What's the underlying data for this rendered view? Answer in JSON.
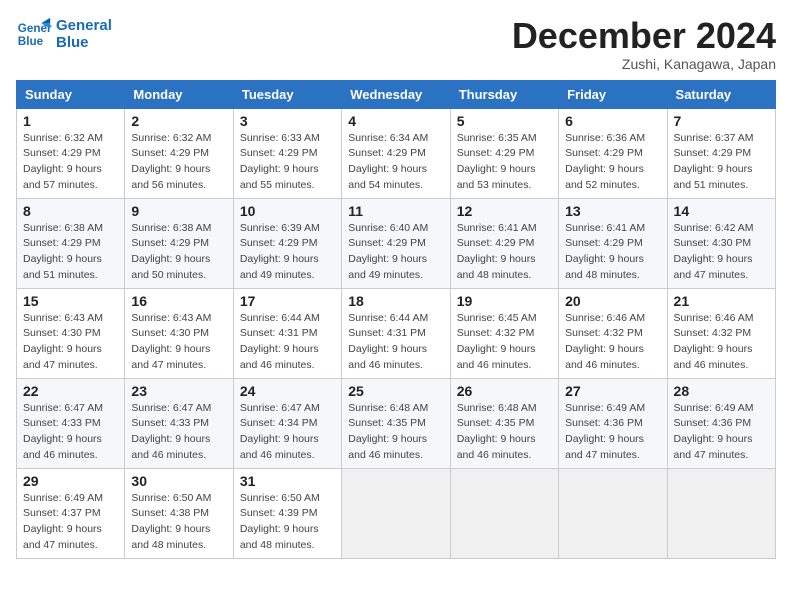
{
  "header": {
    "logo_line1": "General",
    "logo_line2": "Blue",
    "month_title": "December 2024",
    "subtitle": "Zushi, Kanagawa, Japan"
  },
  "weekdays": [
    "Sunday",
    "Monday",
    "Tuesday",
    "Wednesday",
    "Thursday",
    "Friday",
    "Saturday"
  ],
  "weeks": [
    [
      {
        "day": "1",
        "sunrise": "6:32 AM",
        "sunset": "4:29 PM",
        "daylight": "9 hours and 57 minutes."
      },
      {
        "day": "2",
        "sunrise": "6:32 AM",
        "sunset": "4:29 PM",
        "daylight": "9 hours and 56 minutes."
      },
      {
        "day": "3",
        "sunrise": "6:33 AM",
        "sunset": "4:29 PM",
        "daylight": "9 hours and 55 minutes."
      },
      {
        "day": "4",
        "sunrise": "6:34 AM",
        "sunset": "4:29 PM",
        "daylight": "9 hours and 54 minutes."
      },
      {
        "day": "5",
        "sunrise": "6:35 AM",
        "sunset": "4:29 PM",
        "daylight": "9 hours and 53 minutes."
      },
      {
        "day": "6",
        "sunrise": "6:36 AM",
        "sunset": "4:29 PM",
        "daylight": "9 hours and 52 minutes."
      },
      {
        "day": "7",
        "sunrise": "6:37 AM",
        "sunset": "4:29 PM",
        "daylight": "9 hours and 51 minutes."
      }
    ],
    [
      {
        "day": "8",
        "sunrise": "6:38 AM",
        "sunset": "4:29 PM",
        "daylight": "9 hours and 51 minutes."
      },
      {
        "day": "9",
        "sunrise": "6:38 AM",
        "sunset": "4:29 PM",
        "daylight": "9 hours and 50 minutes."
      },
      {
        "day": "10",
        "sunrise": "6:39 AM",
        "sunset": "4:29 PM",
        "daylight": "9 hours and 49 minutes."
      },
      {
        "day": "11",
        "sunrise": "6:40 AM",
        "sunset": "4:29 PM",
        "daylight": "9 hours and 49 minutes."
      },
      {
        "day": "12",
        "sunrise": "6:41 AM",
        "sunset": "4:29 PM",
        "daylight": "9 hours and 48 minutes."
      },
      {
        "day": "13",
        "sunrise": "6:41 AM",
        "sunset": "4:29 PM",
        "daylight": "9 hours and 48 minutes."
      },
      {
        "day": "14",
        "sunrise": "6:42 AM",
        "sunset": "4:30 PM",
        "daylight": "9 hours and 47 minutes."
      }
    ],
    [
      {
        "day": "15",
        "sunrise": "6:43 AM",
        "sunset": "4:30 PM",
        "daylight": "9 hours and 47 minutes."
      },
      {
        "day": "16",
        "sunrise": "6:43 AM",
        "sunset": "4:30 PM",
        "daylight": "9 hours and 47 minutes."
      },
      {
        "day": "17",
        "sunrise": "6:44 AM",
        "sunset": "4:31 PM",
        "daylight": "9 hours and 46 minutes."
      },
      {
        "day": "18",
        "sunrise": "6:44 AM",
        "sunset": "4:31 PM",
        "daylight": "9 hours and 46 minutes."
      },
      {
        "day": "19",
        "sunrise": "6:45 AM",
        "sunset": "4:32 PM",
        "daylight": "9 hours and 46 minutes."
      },
      {
        "day": "20",
        "sunrise": "6:46 AM",
        "sunset": "4:32 PM",
        "daylight": "9 hours and 46 minutes."
      },
      {
        "day": "21",
        "sunrise": "6:46 AM",
        "sunset": "4:32 PM",
        "daylight": "9 hours and 46 minutes."
      }
    ],
    [
      {
        "day": "22",
        "sunrise": "6:47 AM",
        "sunset": "4:33 PM",
        "daylight": "9 hours and 46 minutes."
      },
      {
        "day": "23",
        "sunrise": "6:47 AM",
        "sunset": "4:33 PM",
        "daylight": "9 hours and 46 minutes."
      },
      {
        "day": "24",
        "sunrise": "6:47 AM",
        "sunset": "4:34 PM",
        "daylight": "9 hours and 46 minutes."
      },
      {
        "day": "25",
        "sunrise": "6:48 AM",
        "sunset": "4:35 PM",
        "daylight": "9 hours and 46 minutes."
      },
      {
        "day": "26",
        "sunrise": "6:48 AM",
        "sunset": "4:35 PM",
        "daylight": "9 hours and 46 minutes."
      },
      {
        "day": "27",
        "sunrise": "6:49 AM",
        "sunset": "4:36 PM",
        "daylight": "9 hours and 47 minutes."
      },
      {
        "day": "28",
        "sunrise": "6:49 AM",
        "sunset": "4:36 PM",
        "daylight": "9 hours and 47 minutes."
      }
    ],
    [
      {
        "day": "29",
        "sunrise": "6:49 AM",
        "sunset": "4:37 PM",
        "daylight": "9 hours and 47 minutes."
      },
      {
        "day": "30",
        "sunrise": "6:50 AM",
        "sunset": "4:38 PM",
        "daylight": "9 hours and 48 minutes."
      },
      {
        "day": "31",
        "sunrise": "6:50 AM",
        "sunset": "4:39 PM",
        "daylight": "9 hours and 48 minutes."
      },
      null,
      null,
      null,
      null
    ]
  ]
}
